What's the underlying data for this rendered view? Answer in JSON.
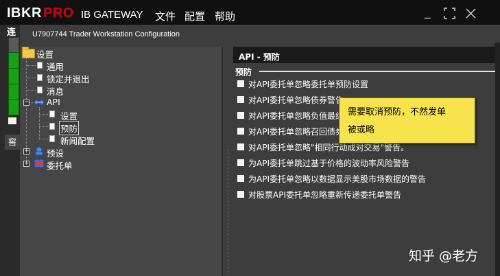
{
  "titlebar": {
    "logo_ibkr": "IBKR",
    "logo_pro": "PRO",
    "app_name": "IB GATEWAY",
    "menus": [
      "文件",
      "配置",
      "帮助"
    ]
  },
  "left_strip": {
    "top_char": "连",
    "tab_char": "窖"
  },
  "config_window": {
    "title": "U7907744 Trader Workstation Configuration"
  },
  "tree": {
    "root": "设置",
    "items": [
      "通用",
      "锁定并退出",
      "消息",
      "API"
    ],
    "api_children": [
      "设置",
      "预防",
      "新闻配置"
    ],
    "presets": "预设",
    "orders": "委托单",
    "selected": "预防"
  },
  "panel": {
    "header": "API - 预防",
    "group": "预防",
    "checkboxes": [
      "对API委托单忽略委托单预防设置",
      "对API委托单忽略债券警告",
      "对API委托单忽略负值最终",
      "对API委托单忽略召回债券",
      "对API委托单忽略\"相同行动成对交易\"警告。",
      "为API委托单跳过基于价格的波动率风险警告",
      "为API委托单忽略以数据显示美股市场数据的警告",
      "对股票API委托单忽略重新传递委托单警告"
    ]
  },
  "tooltip": {
    "line1": "需要取消预防，不然发单",
    "line2": "被或略"
  },
  "watermark": "知乎 @老方",
  "colors": {
    "brand_red": "#d0021b",
    "status_green": "#17a117",
    "tooltip_yellow": "#f7e34b"
  }
}
